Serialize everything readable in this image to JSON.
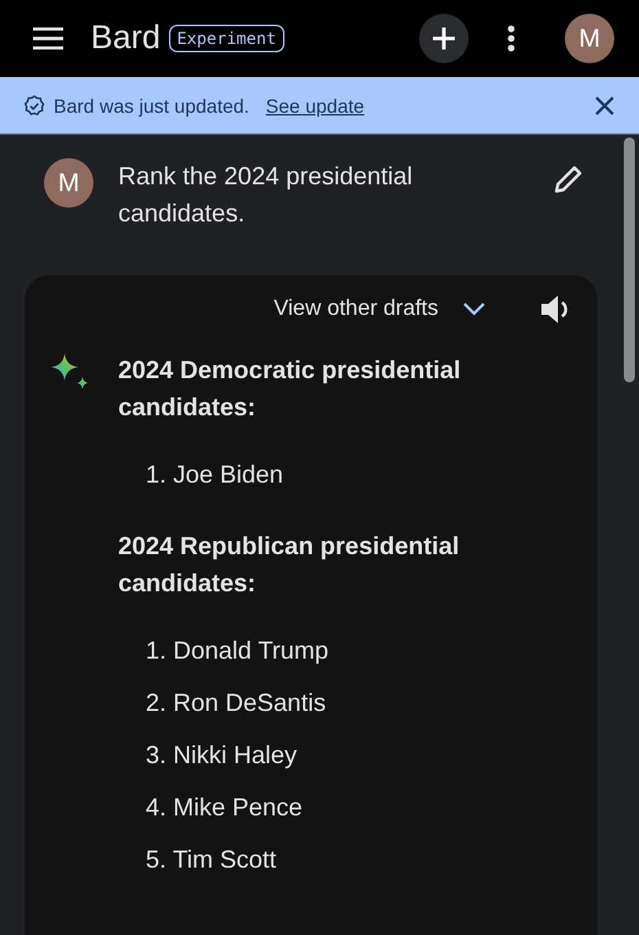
{
  "header": {
    "title": "Bard",
    "badge": "Experiment",
    "avatar": "M"
  },
  "banner": {
    "message": "Bard was just updated.",
    "link": "See update"
  },
  "prompt": {
    "avatar": "M",
    "text": "Rank the 2024 presidential candidates."
  },
  "response": {
    "drafts_label": "View other drafts",
    "sections": [
      {
        "heading": "2024 Democratic presidential candidates:",
        "items": [
          "1. Joe Biden"
        ]
      },
      {
        "heading": "2024 Republican presidential candidates:",
        "items": [
          "1. Donald Trump",
          "2. Ron DeSantis",
          "3. Nikki Haley",
          "4. Mike Pence",
          "5. Tim Scott"
        ]
      }
    ]
  }
}
